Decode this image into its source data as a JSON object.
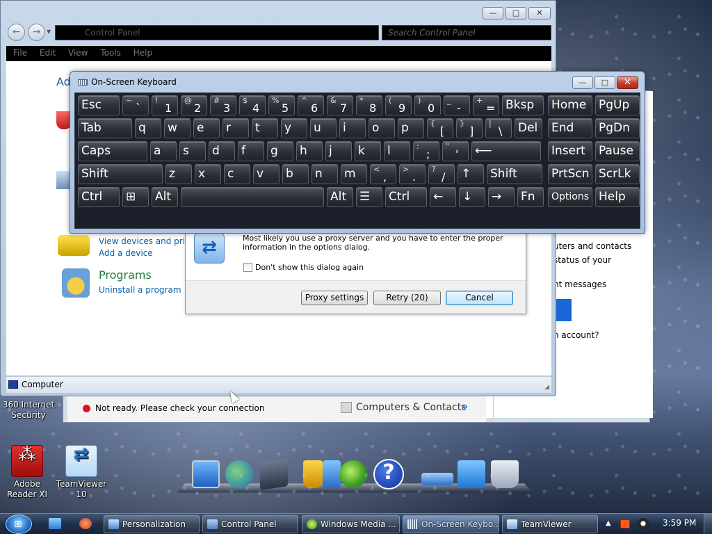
{
  "desktop": {
    "icons": [
      {
        "label": "360 Internet Security",
        "icon": "shield-icon"
      },
      {
        "label": "Adobe Reader XI",
        "icon": "pdf-icon"
      },
      {
        "label": "TeamViewer 10",
        "icon": "teamviewer-icon"
      }
    ],
    "dock": {
      "help_glyph": "?"
    }
  },
  "control_panel": {
    "address_text": "Control Panel",
    "search_placeholder": "Search Control Panel",
    "menu": [
      "File",
      "Edit",
      "View",
      "Tools",
      "Help"
    ],
    "partial_heading": "Ad",
    "hardware_link_1": "View devices and printe",
    "hardware_link_2": "Add a device",
    "programs_heading": "Programs",
    "programs_link": "Uninstall a program",
    "status_text": "Computer",
    "window_controls": {
      "minimize": "—",
      "maximize": "□",
      "close": "✕"
    }
  },
  "teamviewer": {
    "status_text": "Not ready. Please check your connection",
    "computers_contacts": "Computers & Contacts",
    "chevron": "»",
    "right_panel": {
      "line1": "uters and contacts",
      "line2": "status of your",
      "line3": "nt messages",
      "line4": "n account?"
    }
  },
  "proxy_dialog": {
    "message": "Most likely you use a proxy server and you have to enter the proper information in the options dialog.",
    "checkbox_label": "Don't show this dialog again",
    "checkbox_checked": false,
    "buttons": {
      "proxy": "Proxy settings",
      "retry": "Retry (20)",
      "cancel": "Cancel"
    }
  },
  "osk": {
    "title": "On-Screen Keyboard",
    "rows": [
      [
        {
          "label": "Esc"
        },
        {
          "shift": "~",
          "base": "`"
        },
        {
          "shift": "!",
          "base": "1"
        },
        {
          "shift": "@",
          "base": "2"
        },
        {
          "shift": "#",
          "base": "3"
        },
        {
          "shift": "$",
          "base": "4"
        },
        {
          "shift": "%",
          "base": "5"
        },
        {
          "shift": "^",
          "base": "6"
        },
        {
          "shift": "&",
          "base": "7"
        },
        {
          "shift": "*",
          "base": "8"
        },
        {
          "shift": "(",
          "base": "9"
        },
        {
          "shift": ")",
          "base": "0"
        },
        {
          "shift": "_",
          "base": "-"
        },
        {
          "shift": "+",
          "base": "="
        },
        {
          "label": "Bksp"
        },
        {
          "label": "Home"
        },
        {
          "label": "PgUp"
        }
      ],
      [
        {
          "label": "Tab"
        },
        {
          "label": "q"
        },
        {
          "label": "w"
        },
        {
          "label": "e"
        },
        {
          "label": "r"
        },
        {
          "label": "t"
        },
        {
          "label": "y"
        },
        {
          "label": "u"
        },
        {
          "label": "i"
        },
        {
          "label": "o"
        },
        {
          "label": "p"
        },
        {
          "shift": "{",
          "base": "["
        },
        {
          "shift": "}",
          "base": "]"
        },
        {
          "shift": "|",
          "base": "\\"
        },
        {
          "label": "Del"
        },
        {
          "label": "End"
        },
        {
          "label": "PgDn"
        }
      ],
      [
        {
          "label": "Caps"
        },
        {
          "label": "a"
        },
        {
          "label": "s"
        },
        {
          "label": "d"
        },
        {
          "label": "f"
        },
        {
          "label": "g"
        },
        {
          "label": "h"
        },
        {
          "label": "j"
        },
        {
          "label": "k"
        },
        {
          "label": "l"
        },
        {
          "shift": ":",
          "base": ";"
        },
        {
          "shift": "\"",
          "base": "'"
        },
        {
          "label": "⟵"
        },
        {
          "label": "Insert"
        },
        {
          "label": "Pause"
        }
      ],
      [
        {
          "label": "Shift"
        },
        {
          "label": "z"
        },
        {
          "label": "x"
        },
        {
          "label": "c"
        },
        {
          "label": "v"
        },
        {
          "label": "b"
        },
        {
          "label": "n"
        },
        {
          "label": "m"
        },
        {
          "shift": "<",
          "base": ","
        },
        {
          "shift": ">",
          "base": "."
        },
        {
          "shift": "?",
          "base": "/"
        },
        {
          "label": "↑"
        },
        {
          "label": "Shift"
        },
        {
          "label": "PrtScn"
        },
        {
          "label": "ScrLk"
        }
      ],
      [
        {
          "label": "Ctrl"
        },
        {
          "label": "⊞"
        },
        {
          "label": "Alt"
        },
        {
          "label": ""
        },
        {
          "label": "Alt"
        },
        {
          "label": "☰"
        },
        {
          "label": "Ctrl"
        },
        {
          "label": "←"
        },
        {
          "label": "↓"
        },
        {
          "label": "→"
        },
        {
          "label": "Fn"
        },
        {
          "label": "Options"
        },
        {
          "label": "Help"
        }
      ]
    ]
  },
  "taskbar": {
    "tasks": [
      {
        "label": "Personalization",
        "active": false
      },
      {
        "label": "Control Panel",
        "active": false
      },
      {
        "label": "Windows Media ...",
        "active": false
      },
      {
        "label": "On-Screen Keybo...",
        "active": true
      },
      {
        "label": "TeamViewer",
        "active": false
      }
    ],
    "clock": "3:59 PM",
    "tray_arrow": "▲"
  },
  "colors": {
    "key_bg": "#2d3138",
    "accent_blue": "#1a66d6",
    "status_red": "#e01020",
    "cp_link": "#0a5fa8",
    "cp_heading": "#1e7a3a"
  }
}
